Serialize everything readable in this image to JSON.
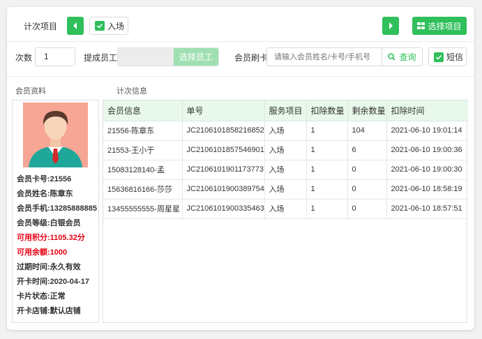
{
  "header": {
    "title": "计次项目",
    "entry_checkbox_label": "入场",
    "select_project_label": "选择项目"
  },
  "form": {
    "count_label": "次数",
    "count_value": "1",
    "employee_label": "提成员工",
    "select_employee_label": "选择员工",
    "card_label": "会员刷卡",
    "card_placeholder": "请输入会员姓名/卡号/手机号",
    "query_label": "查询",
    "sms_label": "短信"
  },
  "sections": {
    "member_info_title": "会员资料",
    "count_info_title": "计次信息"
  },
  "member": {
    "card_no": "会员卡号:21556",
    "name": "会员姓名:陈章东",
    "phone": "会员手机:13285888885",
    "level": "会员等级:白银会员",
    "points": "可用积分:1105.32分",
    "balance": "可用余额:1000",
    "expire": "过期时间:永久有效",
    "open_date": "开卡时间:2020-04-17",
    "status": "卡片状态:正常",
    "store": "开卡店铺:默认店铺"
  },
  "table": {
    "headers": [
      "会员信息",
      "单号",
      "服务项目",
      "扣除数量",
      "剩余数量",
      "扣除时间"
    ],
    "rows": [
      [
        "21556-陈章东",
        "JC2106101858216852",
        "入场",
        "1",
        "104",
        "2021-06-10  19:01:14"
      ],
      [
        "21553-王小于",
        "JC2106101857546901",
        "入场",
        "1",
        "6",
        "2021-06-10  19:00:36"
      ],
      [
        "15083128140-孟",
        "JC2106101901173773",
        "入场",
        "1",
        "0",
        "2021-06-10  19:00:30"
      ],
      [
        "15636816166-莎莎",
        "JC2106101900389754",
        "入场",
        "1",
        "0",
        "2021-06-10  18:58:19"
      ],
      [
        "13455555555-周星星",
        "JC2106101900335463",
        "入场",
        "1",
        "0",
        "2021-06-10  18:57:51"
      ]
    ]
  },
  "colors": {
    "accent": "#2fbf5b",
    "highlight_red": "#e60012",
    "table_header_bg": "#e8f8ea"
  }
}
